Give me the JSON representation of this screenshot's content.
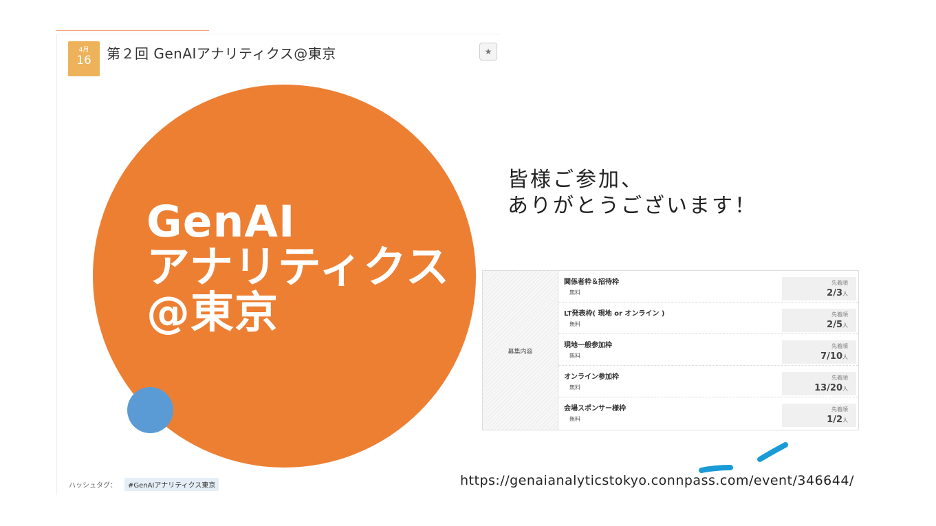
{
  "event": {
    "date_month": "4月",
    "date_day": "16",
    "title": "第２回 GenAIアナリティクス@東京",
    "bookmark_icon": "★",
    "logo_lines": [
      "GenAI",
      "アナリティクス",
      "@東京"
    ],
    "hashtag_label": "ハッシュタグ：",
    "hashtag": "#GenAIアナリティクス東京"
  },
  "slide": {
    "thanks_line1": "皆様ご参加、",
    "thanks_line2": "ありがとうございます！",
    "url": "https://genaianalyticstokyo.connpass.com/event/346644/"
  },
  "recruitment": {
    "header": "募集内容",
    "rows": [
      {
        "name": "関係者枠＆招待枠",
        "fee": "無料",
        "order": "先着順",
        "count": "2/3",
        "unit": "人"
      },
      {
        "name": "LT発表枠( 現地 or オンライン )",
        "fee": "無料",
        "order": "先着順",
        "count": "2/5",
        "unit": "人"
      },
      {
        "name": "現地一般参加枠",
        "fee": "無料",
        "order": "先着順",
        "count": "7/10",
        "unit": "人"
      },
      {
        "name": "オンライン参加枠",
        "fee": "無料",
        "order": "先着順",
        "count": "13/20",
        "unit": "人"
      },
      {
        "name": "会場スポンサー様枠",
        "fee": "無料",
        "order": "先着順",
        "count": "1/2",
        "unit": "人"
      }
    ]
  },
  "colors": {
    "orange_circle": "#ed7f33",
    "blue_circle": "#5b9bd5",
    "date_badge": "#eeb25a",
    "pen_stroke": "#1a9bd7"
  }
}
